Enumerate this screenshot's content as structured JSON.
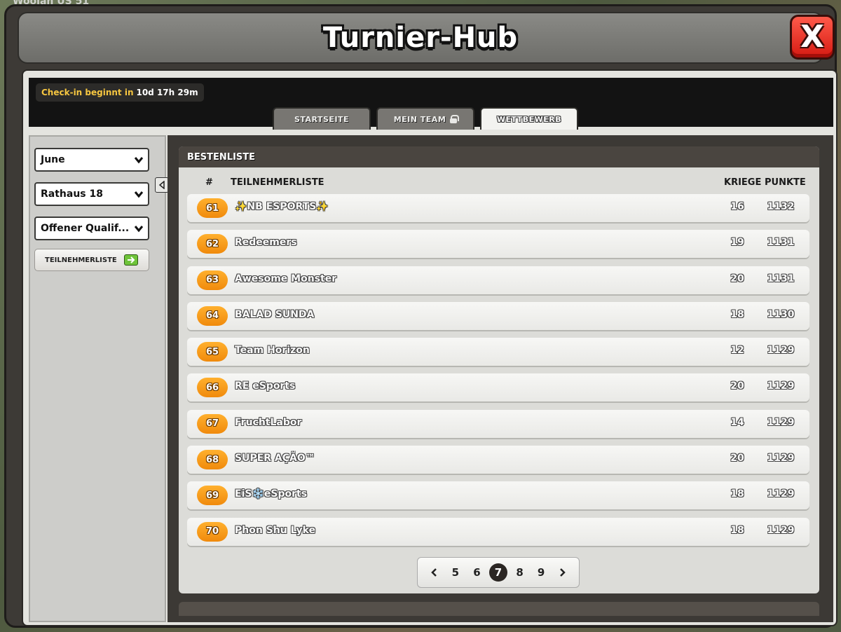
{
  "background": {
    "label": "Woolan ÜS 51"
  },
  "window": {
    "title": "Turnier-Hub",
    "close_label": "X"
  },
  "checkin": {
    "label": "Check-in beginnt in",
    "value": "10d 17h 29m"
  },
  "tabs": [
    {
      "label": "STARTSEITE",
      "locked": false,
      "active": false
    },
    {
      "label": "MEIN TEAM",
      "locked": true,
      "active": false
    },
    {
      "label": "WETTBEWERB",
      "locked": false,
      "active": true
    }
  ],
  "filters": {
    "month": "June",
    "townhall": "Rathaus 18",
    "stage": "Offener Qualif...",
    "participants_button": "TEILNEHMERLISTE"
  },
  "leaderboard": {
    "title": "BESTENLISTE",
    "columns": {
      "rank": "#",
      "team": "TEILNEHMERLISTE",
      "wars": "KRIEGE",
      "points": "PUNKTE"
    },
    "rows": [
      {
        "rank": "61",
        "team": "✨NB ESPORTS✨",
        "wars": "16",
        "points": "1132"
      },
      {
        "rank": "62",
        "team": "Redeemers",
        "wars": "19",
        "points": "1131"
      },
      {
        "rank": "63",
        "team": "Awesome Monster",
        "wars": "20",
        "points": "1131"
      },
      {
        "rank": "64",
        "team": "BALAD SUNDA",
        "wars": "18",
        "points": "1130"
      },
      {
        "rank": "65",
        "team": "Team Horizon",
        "wars": "12",
        "points": "1129"
      },
      {
        "rank": "66",
        "team": "RE eSports",
        "wars": "20",
        "points": "1129"
      },
      {
        "rank": "67",
        "team": "FruchtLabor",
        "wars": "14",
        "points": "1129"
      },
      {
        "rank": "68",
        "team": "SUPER AÇÃO™",
        "wars": "20",
        "points": "1129"
      },
      {
        "rank": "69",
        "team": "EiS❄️eSports",
        "wars": "18",
        "points": "1129"
      },
      {
        "rank": "70",
        "team": "Phon Shu Lyke",
        "wars": "18",
        "points": "1129"
      }
    ]
  },
  "pagination": {
    "pages": [
      "5",
      "6",
      "7",
      "8",
      "9"
    ],
    "current": "7"
  },
  "colors": {
    "accent_orange": "#f39a14",
    "close_red": "#e0231a",
    "checkin_gold": "#f6c640",
    "green_arrow": "#6fc43a"
  },
  "icons": {
    "close": "close-icon",
    "lock": "lock-icon",
    "chevron": "chevron-down-icon",
    "arrow_right": "arrow-right-icon",
    "collapse": "chevron-left-icon",
    "prev": "chevron-left-icon",
    "next": "chevron-right-icon"
  }
}
